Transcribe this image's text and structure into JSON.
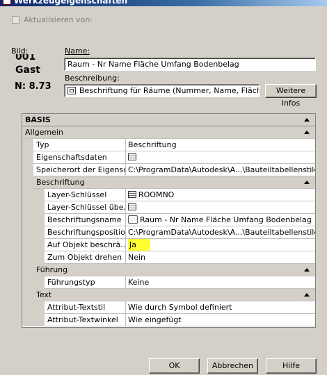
{
  "window": {
    "title": "Werkzeugeigenschaften"
  },
  "update": {
    "label": "Aktualisieren von:",
    "checked": false
  },
  "image": {
    "label": "Bild:",
    "preview_lines": [
      "001",
      "Gast",
      "N:  8.73"
    ]
  },
  "name": {
    "label": "Name:",
    "value": "Raum - Nr Name Fläche Umfang Bodenbelag"
  },
  "description": {
    "label": "Beschreibung:",
    "value": "Beschriftung für Räume  (Nummer, Name, Fläche, Umfang, Bodenbelag)"
  },
  "more_info_button": "Weitere Infos",
  "grid": {
    "basis_header": "BASIS",
    "allgemein": "Allgemein",
    "typ": {
      "label": "Typ",
      "value": "Beschriftung"
    },
    "eigenschaftsdaten": {
      "label": "Eigenschaftsdaten",
      "value": ""
    },
    "speicherort": {
      "label": "Speicherort der Eigensc...",
      "value": "C:\\ProgramData\\Autodesk\\A...\\Bauteiltabellenstile.dwg"
    },
    "beschriftung_cat": "Beschriftung",
    "layer_schluessel": {
      "label": "Layer-Schlüssel",
      "value": "ROOMNO"
    },
    "layer_schluessel_ueb": {
      "label": "Layer-Schlüssel übe...",
      "value": ""
    },
    "beschriftungsname": {
      "label": "Beschriftungsname",
      "value": "Raum - Nr Name Fläche Umfang Bodenbelag"
    },
    "beschriftungsposition": {
      "label": "Beschriftungsposition",
      "value": "C:\\ProgramData\\Autodesk\\A...\\Bauteiltabellenstile.dwg"
    },
    "auf_objekt": {
      "label": "Auf Objekt beschrä...",
      "value": "Ja"
    },
    "zum_objekt_drehen": {
      "label": "Zum Objekt drehen",
      "value": "Nein"
    },
    "fuehrung_cat": "Führung",
    "fuehrungstyp": {
      "label": "Führungstyp",
      "value": "Keine"
    },
    "text_cat": "Text",
    "attribut_textstil": {
      "label": "Attribut-Textstil",
      "value": "Wie durch Symbol definiert"
    },
    "attribut_textwinkel": {
      "label": "Attribut-Textwinkel",
      "value": "Wie eingefügt"
    }
  },
  "buttons": {
    "ok": "OK",
    "abbrechen": "Abbrechen",
    "hilfe": "Hilfe"
  },
  "colors": {
    "highlight": "#ffff33",
    "titlebar": "#0a246a",
    "dialog_bg": "#d4d0c8"
  }
}
